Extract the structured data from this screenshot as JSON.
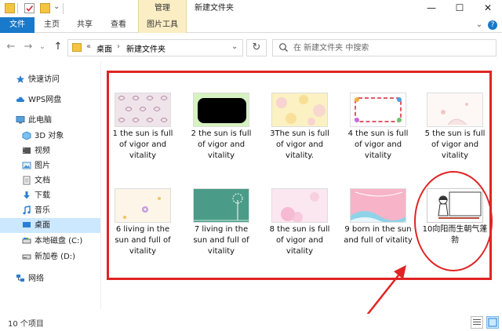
{
  "titlebar": {
    "tool_tab_header": "管理",
    "window_title": "新建文件夹",
    "minimize": "—",
    "maximize": "☐",
    "close": "✕"
  },
  "ribbon": {
    "tabs": [
      "文件",
      "主页",
      "共享",
      "查看",
      "图片工具"
    ],
    "expand_icon": "⌄",
    "help_icon": "?"
  },
  "nav": {
    "back": "←",
    "forward": "→",
    "history": "⌄",
    "up": "↑",
    "breadcrumb_overflow": "«",
    "crumbs": [
      "桌面",
      "新建文件夹"
    ],
    "separator": "›",
    "dropdown": "⌄",
    "refresh": "↻"
  },
  "search": {
    "placeholder": "在 新建文件夹 中搜索"
  },
  "sidebar": {
    "items": [
      {
        "label": "快速访问",
        "icon": "star-icon",
        "color": "#2a7fd4"
      },
      {
        "label": "WPS网盘",
        "icon": "cloud-icon",
        "color": "#2a7fd4"
      },
      {
        "label": "此电脑",
        "icon": "computer-icon",
        "color": "#5aa0d8"
      },
      {
        "label": "3D 对象",
        "icon": "cube-icon",
        "color": "#4a9ee0"
      },
      {
        "label": "视频",
        "icon": "video-icon",
        "color": "#555"
      },
      {
        "label": "图片",
        "icon": "picture-icon",
        "color": "#4a8fcf"
      },
      {
        "label": "文档",
        "icon": "document-icon",
        "color": "#777"
      },
      {
        "label": "下载",
        "icon": "download-icon",
        "color": "#2a7fd4"
      },
      {
        "label": "音乐",
        "icon": "music-icon",
        "color": "#2a7fd4"
      },
      {
        "label": "桌面",
        "icon": "desktop-icon",
        "color": "#2a7fd4"
      },
      {
        "label": "本地磁盘 (C:)",
        "icon": "drive-icon",
        "color": "#666"
      },
      {
        "label": "新加卷 (D:)",
        "icon": "drive-icon",
        "color": "#666"
      },
      {
        "label": "网络",
        "icon": "network-icon",
        "color": "#2a7fd4"
      }
    ]
  },
  "files": [
    {
      "name": "1 the sun is full of vigor and vitality",
      "thumb": "pink-damask"
    },
    {
      "name": "2 the sun is full of vigor and vitality",
      "thumb": "green-black-frame"
    },
    {
      "name": "3The sun is full of vigor and vitality.",
      "thumb": "yellow-flowers"
    },
    {
      "name": "4 the sun is full of vigor and vitality",
      "thumb": "colorful-frame"
    },
    {
      "name": "5 the sun is full of vigor and vitality",
      "thumb": "white-dots"
    },
    {
      "name": "6 living in the sun and full of vitality",
      "thumb": "cream-flowers"
    },
    {
      "name": "7 living in the sun and full of vitality",
      "thumb": "teal-dandelion"
    },
    {
      "name": "8 the sun is full of vigor and vitality",
      "thumb": "pink-blossom"
    },
    {
      "name": "9 born in the sun and full of vitality",
      "thumb": "pink-sky"
    },
    {
      "name": "10向阳而生朝气蓬勃",
      "thumb": "sketch-girl"
    }
  ],
  "status": {
    "item_count": "10 个项目"
  },
  "colors": {
    "accent": "#1979ca",
    "highlight": "#e02424",
    "selected": "#cce8ff",
    "tool_tab": "#fbeec4"
  }
}
